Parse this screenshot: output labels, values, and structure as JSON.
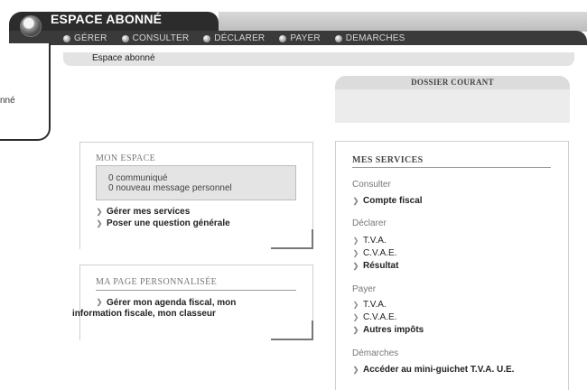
{
  "header": {
    "app_title": "ESPACE ABONNÉ",
    "logo_icon": "circle-logo-icon"
  },
  "nav": [
    {
      "label": "GÉRER"
    },
    {
      "label": "CONSULTER"
    },
    {
      "label": "DÉCLARER"
    },
    {
      "label": "PAYER"
    },
    {
      "label": "DEMARCHES"
    }
  ],
  "side": {
    "label": "nné"
  },
  "breadcrumb": {
    "text": "Espace abonné"
  },
  "dossier": {
    "title": "DOSSIER COURANT"
  },
  "mon_espace": {
    "title": "MON ESPACE",
    "messages": [
      "0 communiqué",
      "0 nouveau message personnel"
    ],
    "links": [
      "Gérer mes services",
      "Poser une question générale"
    ]
  },
  "ma_page": {
    "title": "MA PAGE PERSONNALISÉE",
    "link": "Gérer mon agenda fiscal, mon information fiscale, mon classeur"
  },
  "services": {
    "title": "MES SERVICES",
    "consulter": {
      "label": "Consulter",
      "links": [
        "Compte fiscal"
      ]
    },
    "declarer": {
      "label": "Déclarer",
      "links": [
        "T.V.A.",
        "C.V.A.E.",
        "Résultat"
      ]
    },
    "payer": {
      "label": "Payer",
      "links": [
        "T.V.A.",
        "C.V.A.E.",
        "Autres impôts"
      ]
    },
    "demarches": {
      "label": "Démarches",
      "links": [
        "Accéder au mini-guichet T.V.A. U.E."
      ]
    }
  },
  "colors": {
    "dark": "#2c2c2c",
    "panel": "#e4e4e4",
    "accent": "#777777"
  }
}
